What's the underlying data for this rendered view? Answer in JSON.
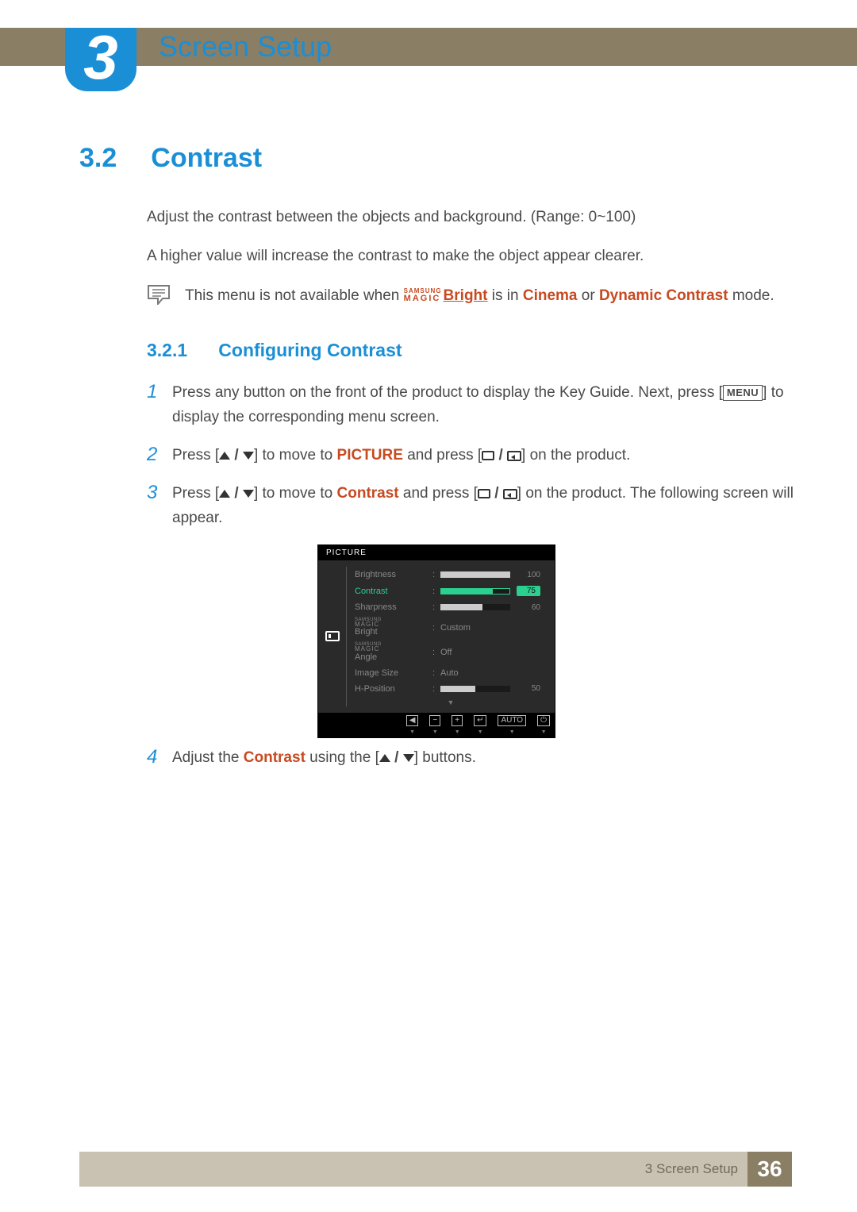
{
  "chapter": {
    "number": "3",
    "title": "Screen Setup"
  },
  "section": {
    "number": "3.2",
    "title": "Contrast"
  },
  "intro": {
    "line1": "Adjust the contrast between the objects and background. (Range: 0~100)",
    "line2": "A higher value will increase the contrast to make the object appear clearer."
  },
  "note": {
    "pre": "This menu is not available when ",
    "magic_line1": "SAMSUNG",
    "magic_line2": "MAGIC",
    "bright": "Bright",
    "mid": " is in ",
    "mode1": "Cinema",
    "or": " or ",
    "mode2": "Dynamic Contrast",
    "post": " mode."
  },
  "subsection": {
    "number": "3.2.1",
    "title": "Configuring Contrast"
  },
  "steps": {
    "s1": {
      "num": "1",
      "pre": "Press any button on the front of the product to display the Key Guide. Next, press [",
      "menu": "MENU",
      "post": "] to display the corresponding menu screen."
    },
    "s2": {
      "num": "2",
      "pre": "Press [",
      "mid": "] to move to ",
      "target": "PICTURE",
      "post1": " and press [",
      "post2": "] on the product."
    },
    "s3": {
      "num": "3",
      "pre": "Press [",
      "mid": "] to move to ",
      "target": "Contrast",
      "post1": " and press [",
      "post2": "] on the product. The following screen will appear."
    },
    "s4": {
      "num": "4",
      "pre": "Adjust the ",
      "target": "Contrast",
      "mid": " using the [",
      "post": "] buttons."
    }
  },
  "osd": {
    "title": "PICTURE",
    "rows": [
      {
        "label": "Brightness",
        "type": "slider",
        "value": 100,
        "pct": 100,
        "active": false
      },
      {
        "label": "Contrast",
        "type": "slider",
        "value": 75,
        "pct": 75,
        "active": true
      },
      {
        "label": "Sharpness",
        "type": "slider",
        "value": 60,
        "pct": 60,
        "active": false
      },
      {
        "label": "MAGIC Bright",
        "type": "text",
        "text": "Custom",
        "magic": true
      },
      {
        "label": "MAGIC Angle",
        "type": "text",
        "text": "Off",
        "magic": true
      },
      {
        "label": "Image Size",
        "type": "text",
        "text": "Auto"
      },
      {
        "label": "H-Position",
        "type": "slider",
        "value": 50,
        "pct": 50,
        "active": false
      }
    ],
    "footer": [
      "◀",
      "−",
      "+",
      "↵",
      "AUTO",
      "⏻"
    ]
  },
  "footer": {
    "label": "3 Screen Setup",
    "page": "36"
  },
  "chart_data": {
    "type": "table",
    "title": "PICTURE OSD menu values",
    "items": [
      {
        "name": "Brightness",
        "value": 100
      },
      {
        "name": "Contrast",
        "value": 75
      },
      {
        "name": "Sharpness",
        "value": 60
      },
      {
        "name": "SAMSUNG MAGIC Bright",
        "value": "Custom"
      },
      {
        "name": "SAMSUNG MAGIC Angle",
        "value": "Off"
      },
      {
        "name": "Image Size",
        "value": "Auto"
      },
      {
        "name": "H-Position",
        "value": 50
      }
    ]
  }
}
